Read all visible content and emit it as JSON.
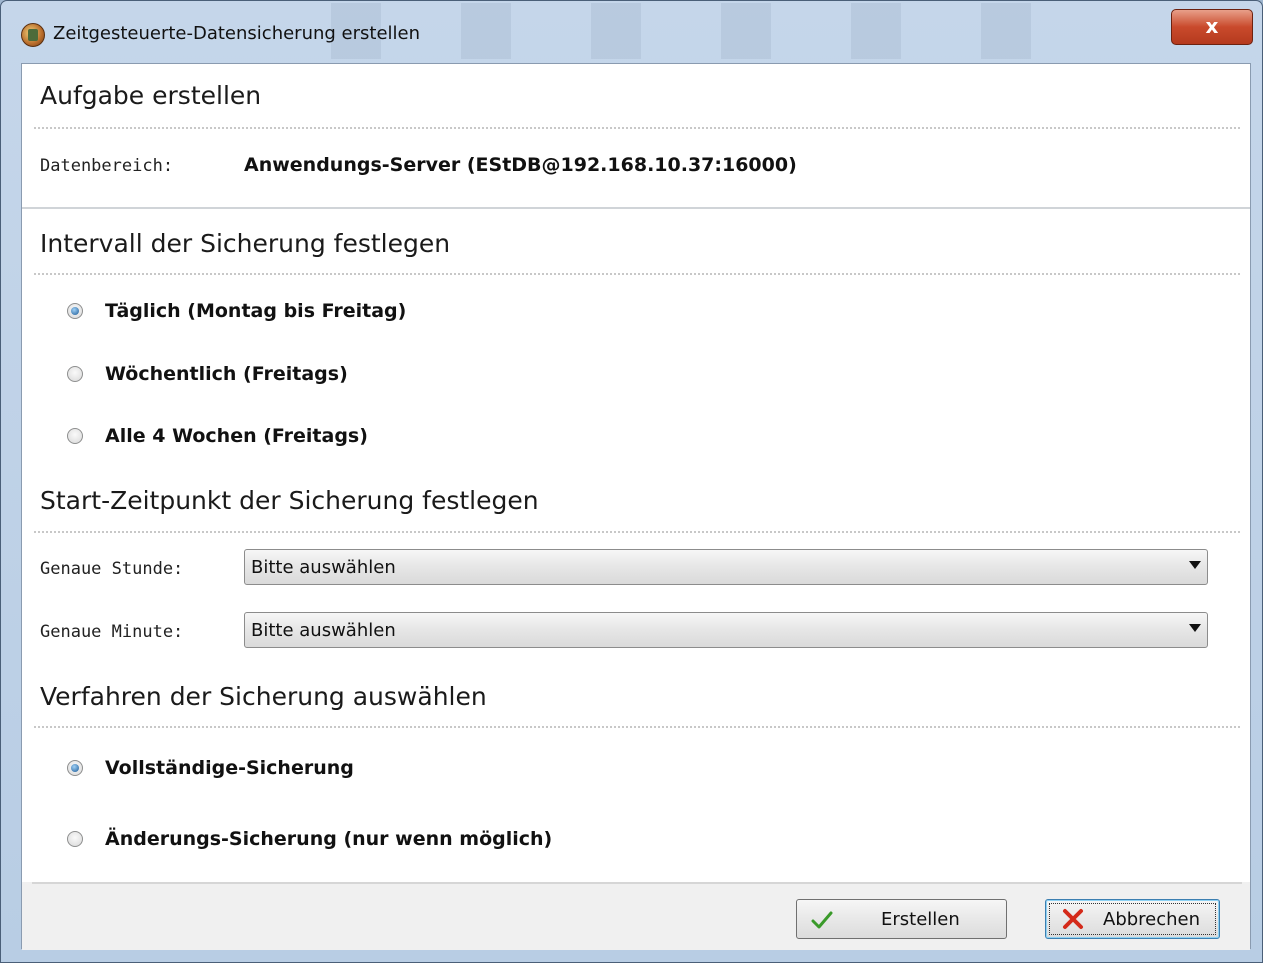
{
  "window": {
    "title": "Zeitgesteuerte-Datensicherung erstellen",
    "close_label": "x"
  },
  "task": {
    "heading": "Aufgabe erstellen",
    "datenbereich_label": "Datenbereich:",
    "datenbereich_value": "Anwendungs-Server (EStDB@192.168.10.37:16000)"
  },
  "interval": {
    "heading": "Intervall der Sicherung festlegen",
    "options": [
      {
        "label": "Täglich (Montag bis Freitag)",
        "checked": true
      },
      {
        "label": "Wöchentlich (Freitags)",
        "checked": false
      },
      {
        "label": "Alle 4 Wochen (Freitags)",
        "checked": false
      }
    ]
  },
  "start": {
    "heading": "Start-Zeitpunkt der Sicherung festlegen",
    "hour_label": "Genaue Stunde:",
    "hour_value": "Bitte auswählen",
    "minute_label": "Genaue Minute:",
    "minute_value": "Bitte auswählen"
  },
  "method": {
    "heading": "Verfahren der Sicherung auswählen",
    "options": [
      {
        "label": "Vollständige-Sicherung",
        "checked": true
      },
      {
        "label": "Änderungs-Sicherung (nur wenn möglich)",
        "checked": false
      }
    ]
  },
  "buttons": {
    "create": "Erstellen",
    "cancel": "Abbrechen"
  },
  "colors": {
    "check_icon": "#3a9a2a",
    "cancel_icon": "#d42a1a",
    "close_button": "#c94a2c"
  }
}
